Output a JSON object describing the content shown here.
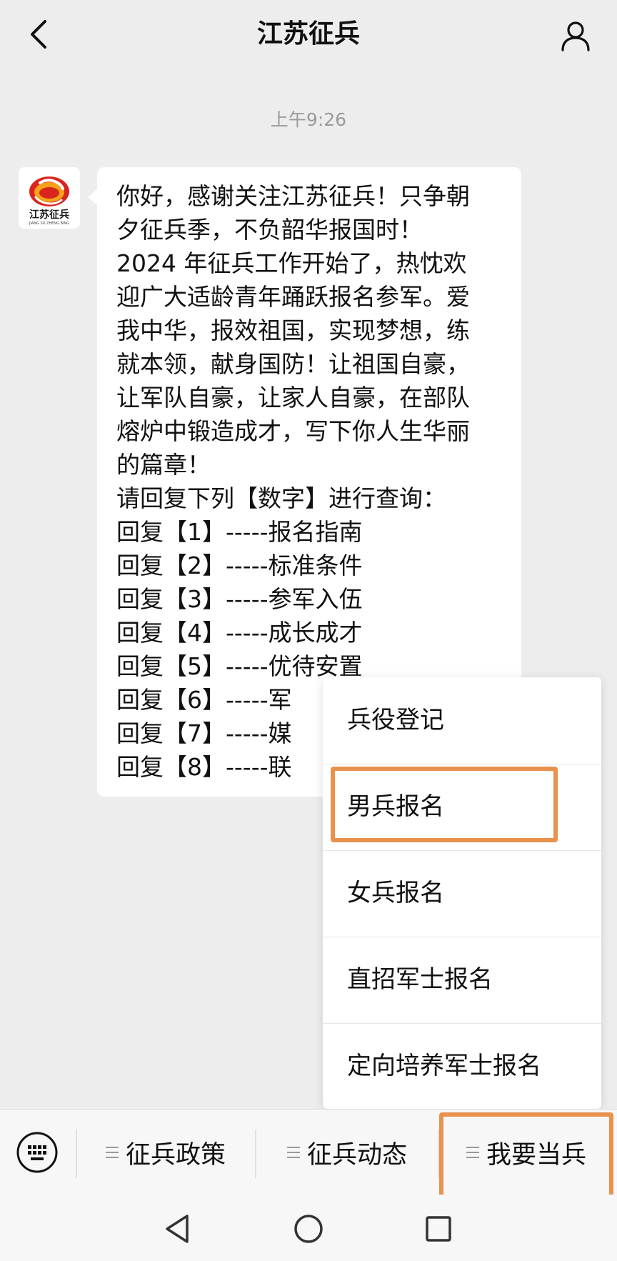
{
  "header": {
    "title": "江苏征兵"
  },
  "chat": {
    "timestamp": "上午9:26",
    "avatar": {
      "logo_text": "江苏征兵",
      "logo_subtext": "JIANG SU ZHENG BING"
    },
    "message_lines": [
      "你好，感谢关注江苏征兵！只争朝",
      "夕征兵季，不负韶华报国时！",
      "2024 年征兵工作开始了，热忱欢",
      "迎广大适龄青年踊跃报名参军。爱",
      "我中华，报效祖国，实现梦想，练",
      "就本领，献身国防！让祖国自豪，",
      "让军队自豪，让家人自豪，在部队",
      "熔炉中锻造成才，写下你人生华丽",
      "的篇章！",
      "请回复下列【数字】进行查询：",
      "回复【1】-----报名指南",
      "回复【2】-----标准条件",
      "回复【3】-----参军入伍",
      "回复【4】-----成长成才",
      "回复【5】-----优待安置",
      "回复【6】-----军",
      "回复【7】-----媒",
      "回复【8】-----联"
    ]
  },
  "popup_menu": {
    "items": [
      "兵役登记",
      "男兵报名",
      "女兵报名",
      "直招军士报名",
      "定向培养军士报名"
    ]
  },
  "menu_bar": {
    "buttons": [
      "征兵政策",
      "征兵动态",
      "我要当兵"
    ]
  },
  "colors": {
    "background": "#ededed",
    "bubble": "#ffffff",
    "highlight": "#e8924e",
    "timestamp": "#9a9a9a",
    "logo_red": "#d9251d",
    "logo_orange": "#f5a11b"
  },
  "icons": {
    "back": "chevron-left-icon",
    "profile": "person-icon",
    "keyboard": "keyboard-icon",
    "menu_lines": "three-lines-icon",
    "nav_back": "triangle-back-icon",
    "nav_home": "circle-home-icon",
    "nav_recents": "square-recents-icon"
  }
}
